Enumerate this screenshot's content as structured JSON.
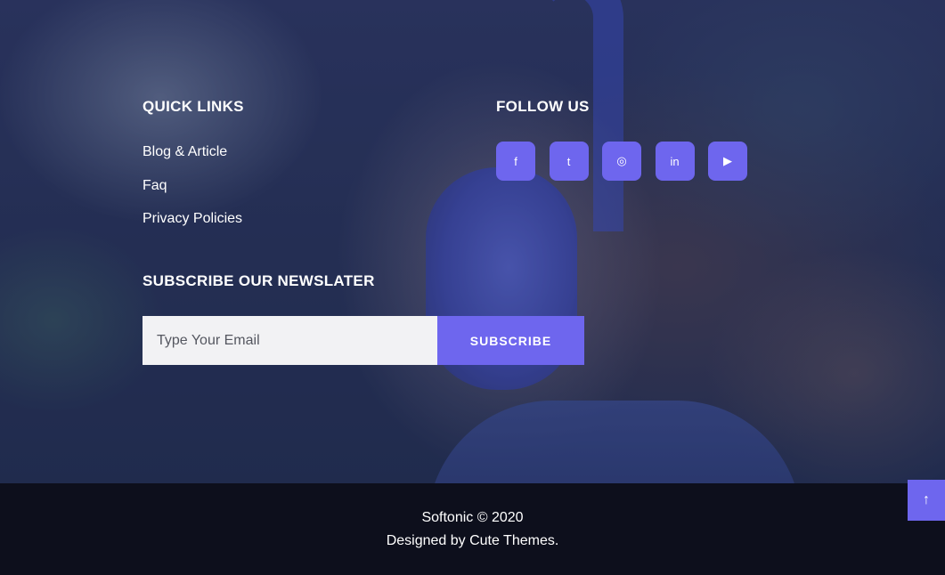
{
  "quick_links": {
    "heading": "QUICK LINKS",
    "items": [
      {
        "label": "Blog & Article"
      },
      {
        "label": "Faq"
      },
      {
        "label": "Privacy Policies"
      }
    ]
  },
  "follow_us": {
    "heading": "FOLLOW US",
    "socials": [
      {
        "icon": "facebook-icon",
        "glyph": "f"
      },
      {
        "icon": "twitter-icon",
        "glyph": "t"
      },
      {
        "icon": "instagram-icon",
        "glyph": "◎"
      },
      {
        "icon": "linkedin-icon",
        "glyph": "in"
      },
      {
        "icon": "youtube-icon",
        "glyph": "▶"
      }
    ]
  },
  "newsletter": {
    "heading": "SUBSCRIBE OUR NEWSLATER",
    "email_placeholder": "Type Your Email",
    "email_value": "",
    "button_label": "SUBSCRIBE"
  },
  "footer": {
    "copyright": "Softonic © 2020",
    "designed_prefix": "Designed by ",
    "designed_link": "Cute Themes",
    "designed_suffix": "."
  },
  "scroll_top": {
    "icon": "arrow-up-icon",
    "glyph": "↑"
  },
  "colors": {
    "accent": "#6e66ee",
    "bottom_bar": "#0d0f1c",
    "input_bg": "#f2f2f4"
  }
}
